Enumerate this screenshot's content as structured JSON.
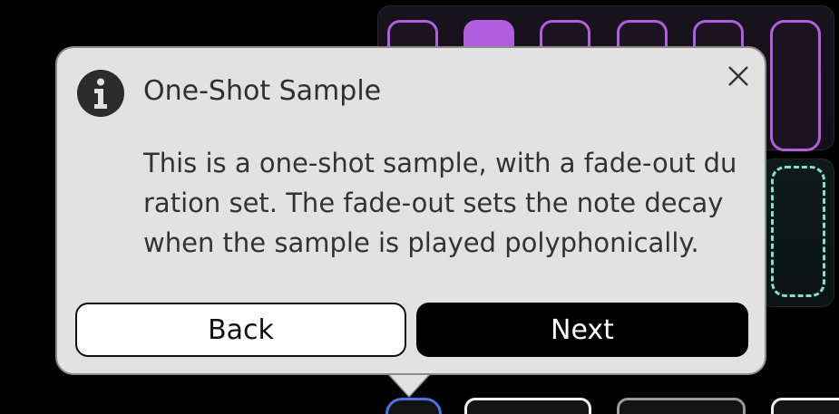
{
  "dialog": {
    "title": "One-Shot Sample",
    "body": "This is a one-shot sample, with a fade-out duration set. The fade-out sets the note decay when the sample is played polyphonically.",
    "back_label": "Back",
    "next_label": "Next",
    "icon": "info-icon",
    "close_icon": "close-icon"
  },
  "pads": {
    "active_index": 1,
    "accent_color": "#b05de0",
    "empty_slot_color": "#7fe0cc"
  },
  "bottom_strip": {
    "selected_color": "#4f70e6"
  }
}
